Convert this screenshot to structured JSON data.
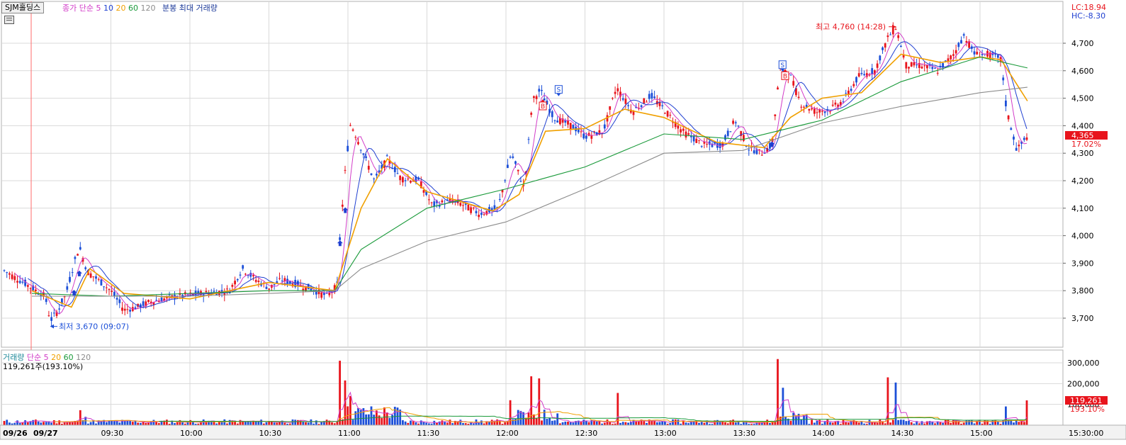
{
  "header": {
    "symbol": "SJM홀딩스",
    "price_ma_label": "종가 단순",
    "ma_periods": [
      "5",
      "10",
      "20",
      "60",
      "120"
    ],
    "max_volume_label": "분봉 최대 거래량",
    "lc": "LC:18.94",
    "hc": "HC:-8.30"
  },
  "volume_header": {
    "label": "거래량",
    "ma_label": "단순",
    "ma_periods": [
      "5",
      "20",
      "60",
      "120"
    ],
    "current": "119,261주(193.10%)"
  },
  "colors": {
    "up": "#e8141c",
    "down": "#1c4fd8",
    "ma5": "#d23cc8",
    "ma10": "#1f3fd1",
    "ma20": "#f0a000",
    "ma60": "#1a9a3a",
    "ma120": "#8c8c8c",
    "grid": "#d9d9d9"
  },
  "chart_data": {
    "type": "candlestick",
    "price_axis": {
      "ticks": [
        3700,
        3800,
        3900,
        4000,
        4100,
        4200,
        4300,
        4400,
        4500,
        4600,
        4700
      ],
      "tick_labels": [
        "3,700",
        "3,800",
        "3,900",
        "4,000",
        "4,100",
        "4,200",
        "4,300",
        "4,400",
        "4,500",
        "4,600",
        "4,700"
      ],
      "range": [
        3610,
        4800
      ]
    },
    "volume_axis": {
      "ticks": [
        100000,
        200000,
        300000
      ],
      "tick_labels": [
        "100,000",
        "200,000",
        "300,000"
      ],
      "range": [
        0,
        330000
      ]
    },
    "time_axis": {
      "labels": [
        "09/26",
        "09/27",
        "09:30",
        "10:00",
        "10:30",
        "11:00",
        "11:30",
        "12:00",
        "12:30",
        "13:00",
        "13:30",
        "14:00",
        "14:30",
        "15:00",
        "15:30:00"
      ],
      "times": [
        "09:00",
        "09:00",
        "09:30",
        "10:00",
        "10:30",
        "11:00",
        "11:30",
        "12:00",
        "12:30",
        "13:00",
        "13:30",
        "14:00",
        "14:30",
        "15:00",
        "15:30"
      ]
    },
    "current_price": {
      "value": 4365,
      "label": "4,365",
      "pct": "17.02%"
    },
    "current_volume": {
      "value": 119261,
      "label": "119,261",
      "pct": "193.10%"
    },
    "annotations": [
      {
        "text": "최저 3,670 (09:07)",
        "time": "09:07",
        "price": 3670,
        "kind": "low"
      },
      {
        "text": "최고 4,760 (14:28)",
        "time": "14:28",
        "price": 4760,
        "kind": "high"
      }
    ],
    "signals": [
      {
        "label": "B",
        "time": "12:14",
        "price": 4450
      },
      {
        "label": "S",
        "time": "12:20",
        "price": 4510
      },
      {
        "label": "S",
        "time": "13:45",
        "price": 4600
      },
      {
        "label": "B",
        "time": "13:46",
        "price": 4560
      }
    ],
    "arrows": [
      {
        "time": "09:16",
        "price": 3790
      },
      {
        "time": "09:18",
        "price": 3860
      },
      {
        "time": "10:57",
        "price": 3970
      },
      {
        "time": "10:59",
        "price": 4090
      },
      {
        "time": "13:41",
        "price": 4330
      }
    ],
    "price_path": [
      [
        "09:00",
        3810
      ],
      [
        "09:05",
        3780
      ],
      [
        "09:07",
        3690
      ],
      [
        "09:10",
        3730
      ],
      [
        "09:13",
        3790
      ],
      [
        "09:16",
        3900
      ],
      [
        "09:18",
        3960
      ],
      [
        "09:21",
        3870
      ],
      [
        "09:25",
        3840
      ],
      [
        "09:30",
        3800
      ],
      [
        "09:35",
        3730
      ],
      [
        "09:40",
        3740
      ],
      [
        "09:45",
        3760
      ],
      [
        "09:55",
        3780
      ],
      [
        "10:05",
        3790
      ],
      [
        "10:15",
        3800
      ],
      [
        "10:20",
        3880
      ],
      [
        "10:25",
        3840
      ],
      [
        "10:30",
        3810
      ],
      [
        "10:35",
        3840
      ],
      [
        "10:45",
        3810
      ],
      [
        "10:52",
        3780
      ],
      [
        "10:56",
        3820
      ],
      [
        "10:57",
        4000
      ],
      [
        "10:59",
        4240
      ],
      [
        "11:01",
        4410
      ],
      [
        "11:05",
        4320
      ],
      [
        "11:10",
        4200
      ],
      [
        "11:15",
        4280
      ],
      [
        "11:20",
        4210
      ],
      [
        "11:27",
        4200
      ],
      [
        "11:32",
        4110
      ],
      [
        "11:40",
        4130
      ],
      [
        "11:50",
        4080
      ],
      [
        "11:57",
        4100
      ],
      [
        "12:02",
        4300
      ],
      [
        "12:07",
        4170
      ],
      [
        "12:10",
        4490
      ],
      [
        "12:13",
        4530
      ],
      [
        "12:18",
        4430
      ],
      [
        "12:25",
        4400
      ],
      [
        "12:30",
        4360
      ],
      [
        "12:37",
        4380
      ],
      [
        "12:42",
        4540
      ],
      [
        "12:48",
        4450
      ],
      [
        "12:55",
        4510
      ],
      [
        "13:00",
        4460
      ],
      [
        "13:07",
        4380
      ],
      [
        "13:15",
        4330
      ],
      [
        "13:22",
        4330
      ],
      [
        "13:27",
        4420
      ],
      [
        "13:32",
        4320
      ],
      [
        "13:37",
        4300
      ],
      [
        "13:41",
        4330
      ],
      [
        "13:44",
        4610
      ],
      [
        "13:48",
        4580
      ],
      [
        "13:52",
        4480
      ],
      [
        "13:58",
        4450
      ],
      [
        "14:03",
        4460
      ],
      [
        "14:08",
        4490
      ],
      [
        "14:14",
        4580
      ],
      [
        "14:20",
        4600
      ],
      [
        "14:25",
        4720
      ],
      [
        "14:28",
        4760
      ],
      [
        "14:32",
        4620
      ],
      [
        "14:37",
        4620
      ],
      [
        "14:44",
        4600
      ],
      [
        "14:50",
        4660
      ],
      [
        "14:54",
        4730
      ],
      [
        "14:58",
        4660
      ],
      [
        "15:03",
        4660
      ],
      [
        "15:08",
        4640
      ],
      [
        "15:10",
        4460
      ],
      [
        "15:14",
        4310
      ],
      [
        "15:18",
        4365
      ]
    ],
    "ma_series": [
      {
        "period": "20",
        "points": [
          [
            "09:00",
            3800
          ],
          [
            "09:15",
            3740
          ],
          [
            "09:22",
            3880
          ],
          [
            "09:35",
            3790
          ],
          [
            "10:00",
            3770
          ],
          [
            "10:30",
            3830
          ],
          [
            "10:55",
            3800
          ],
          [
            "11:05",
            4100
          ],
          [
            "11:15",
            4280
          ],
          [
            "11:30",
            4160
          ],
          [
            "11:55",
            4090
          ],
          [
            "12:05",
            4150
          ],
          [
            "12:15",
            4380
          ],
          [
            "12:30",
            4390
          ],
          [
            "12:45",
            4460
          ],
          [
            "13:00",
            4430
          ],
          [
            "13:20",
            4340
          ],
          [
            "13:38",
            4320
          ],
          [
            "13:48",
            4430
          ],
          [
            "14:00",
            4500
          ],
          [
            "14:15",
            4520
          ],
          [
            "14:30",
            4660
          ],
          [
            "14:45",
            4630
          ],
          [
            "15:00",
            4650
          ],
          [
            "15:08",
            4640
          ],
          [
            "15:18",
            4490
          ]
        ]
      },
      {
        "period": "60",
        "points": [
          [
            "09:00",
            3790
          ],
          [
            "09:30",
            3780
          ],
          [
            "10:00",
            3790
          ],
          [
            "10:30",
            3800
          ],
          [
            "10:55",
            3800
          ],
          [
            "11:05",
            3950
          ],
          [
            "11:30",
            4100
          ],
          [
            "12:00",
            4170
          ],
          [
            "12:30",
            4250
          ],
          [
            "13:00",
            4370
          ],
          [
            "13:30",
            4350
          ],
          [
            "14:00",
            4420
          ],
          [
            "14:30",
            4560
          ],
          [
            "15:00",
            4650
          ],
          [
            "15:18",
            4610
          ]
        ]
      },
      {
        "period": "120",
        "points": [
          [
            "09:00",
            3780
          ],
          [
            "09:30",
            3780
          ],
          [
            "10:00",
            3780
          ],
          [
            "10:30",
            3790
          ],
          [
            "10:55",
            3800
          ],
          [
            "11:05",
            3880
          ],
          [
            "11:30",
            3980
          ],
          [
            "12:00",
            4050
          ],
          [
            "12:30",
            4170
          ],
          [
            "13:00",
            4300
          ],
          [
            "13:30",
            4310
          ],
          [
            "14:00",
            4410
          ],
          [
            "14:30",
            4470
          ],
          [
            "15:00",
            4520
          ],
          [
            "15:18",
            4540
          ]
        ]
      }
    ],
    "volume_spikes": [
      [
        "09:18",
        72000
      ],
      [
        "09:20",
        40000
      ],
      [
        "10:57",
        310000
      ],
      [
        "10:59",
        215000
      ],
      [
        "11:01",
        140000
      ],
      [
        "12:02",
        120000
      ],
      [
        "12:10",
        235000
      ],
      [
        "12:13",
        225000
      ],
      [
        "12:42",
        155000
      ],
      [
        "13:43",
        318000
      ],
      [
        "13:45",
        180000
      ],
      [
        "14:25",
        230000
      ],
      [
        "14:28",
        205000
      ],
      [
        "15:10",
        90000
      ],
      [
        "15:18",
        119261
      ]
    ]
  }
}
